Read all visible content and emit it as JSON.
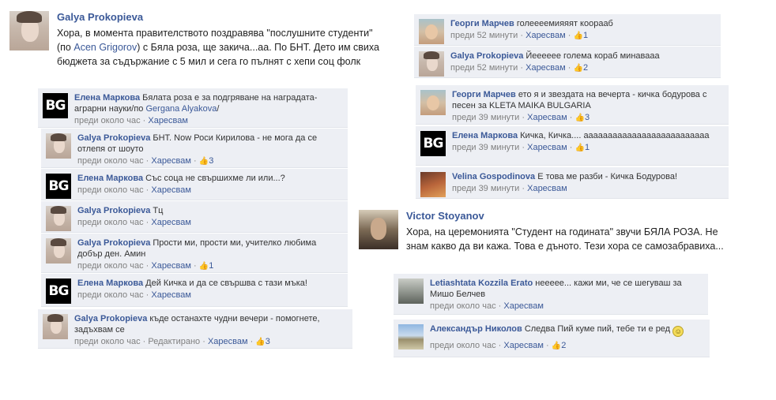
{
  "post1": {
    "author": "Galya Prokopieva",
    "text_before_link": "Хора, в момента правителството поздравява \"послушните студенти\" (по ",
    "link": "Acen Grigorov",
    "text_after_link": ") с Бяла роза, ще закича...аа. По БНТ. Дето им свиха бюджета за съдържание с 5 мил и сега го пълнят с хепи соц фолк"
  },
  "left_comments": [
    {
      "name": "Елена Маркова",
      "text": "Бялата роза е за подгряване на наградата-аграрни науки/по ",
      "link": "Gergana Alyakova",
      "text_tail": "/",
      "time": "преди около час",
      "like": "Харесвам",
      "count": ""
    },
    {
      "name": "Galya Prokopieva",
      "text": "БНТ. Now Роси Кирилова - не мога да се отлепя от шоуто",
      "time": "преди около час",
      "like": "Харесвам",
      "count": "3"
    },
    {
      "name": "Елена Маркова",
      "text": "Със соца не свършихме ли или...?",
      "time": "преди около час",
      "like": "Харесвам",
      "count": ""
    },
    {
      "name": "Galya Prokopieva",
      "text": "Тц",
      "time": "преди около час",
      "like": "Харесвам",
      "count": ""
    },
    {
      "name": "Galya Prokopieva",
      "text": "Прости ми, прости ми, учителко любима добър ден. Амин",
      "time": "преди около час",
      "like": "Харесвам",
      "count": "1"
    },
    {
      "name": "Елена Маркова",
      "text": "Дей Кичка и да се свършва с тази мъка!",
      "time": "преди около час",
      "like": "Харесвам",
      "count": ""
    },
    {
      "name": "Galya Prokopieva",
      "text": "къде останахте чудни вечери - помогнете, задъхвам се",
      "time": "преди около час",
      "edited": "Редактирано",
      "like": "Харесвам",
      "count": "3"
    }
  ],
  "right_top_comments": [
    {
      "name": "Георги Марчев",
      "text": "голеееемияяят коорааб",
      "time": "преди 52 минути",
      "like": "Харесвам",
      "count": "1"
    },
    {
      "name": "Galya Prokopieva",
      "text": "Йееееее голема кораб минавааа",
      "time": "преди 52 минути",
      "like": "Харесвам",
      "count": "2"
    }
  ],
  "right_mid_comments": [
    {
      "name": "Георги Марчев",
      "text": "ето я и звездата на вечерта - кичка бодурова с песен за KLETA MAIKA BULGARIA",
      "time": "преди 39 минути",
      "like": "Харесвам",
      "count": "3"
    },
    {
      "name": "Елена Маркова",
      "text": "Кичка, Кичка.... аааааааааааааааааааааааааа",
      "time": "преди 39 минути",
      "like": "Харесвам",
      "count": "1"
    },
    {
      "name": "Velina Gospodinova",
      "text": "Е това ме разби - Кичка Бодурова!",
      "time": "преди 39 минути",
      "like": "Харесвам",
      "count": ""
    }
  ],
  "post2": {
    "author": "Victor Stoyanov",
    "text": "Хора, на церемонията \"Студент на годината\" звучи БЯЛА РОЗА. Не знам какво да ви кажа. Това е дъното. Тези хора се самозабравиха..."
  },
  "post2_comments": [
    {
      "name": "Letiashtata Kozzila Erato",
      "text": "неееее... кажи ми, че се шегуваш за Мишо Белчев",
      "time": "преди около час",
      "like": "Харесвам",
      "count": ""
    },
    {
      "name": "Александър Николов",
      "text": "Следва Пий куме пий, тебе ти е ред",
      "time": "преди около час",
      "like": "Харесвам",
      "count": "2"
    }
  ],
  "icons": {
    "avatar_bg_text": "BG",
    "thumb": "👍",
    "smiley": "☺"
  },
  "colors": {
    "link": "#3b5998",
    "comment_bg": "#edeff4",
    "meta": "#808080"
  }
}
